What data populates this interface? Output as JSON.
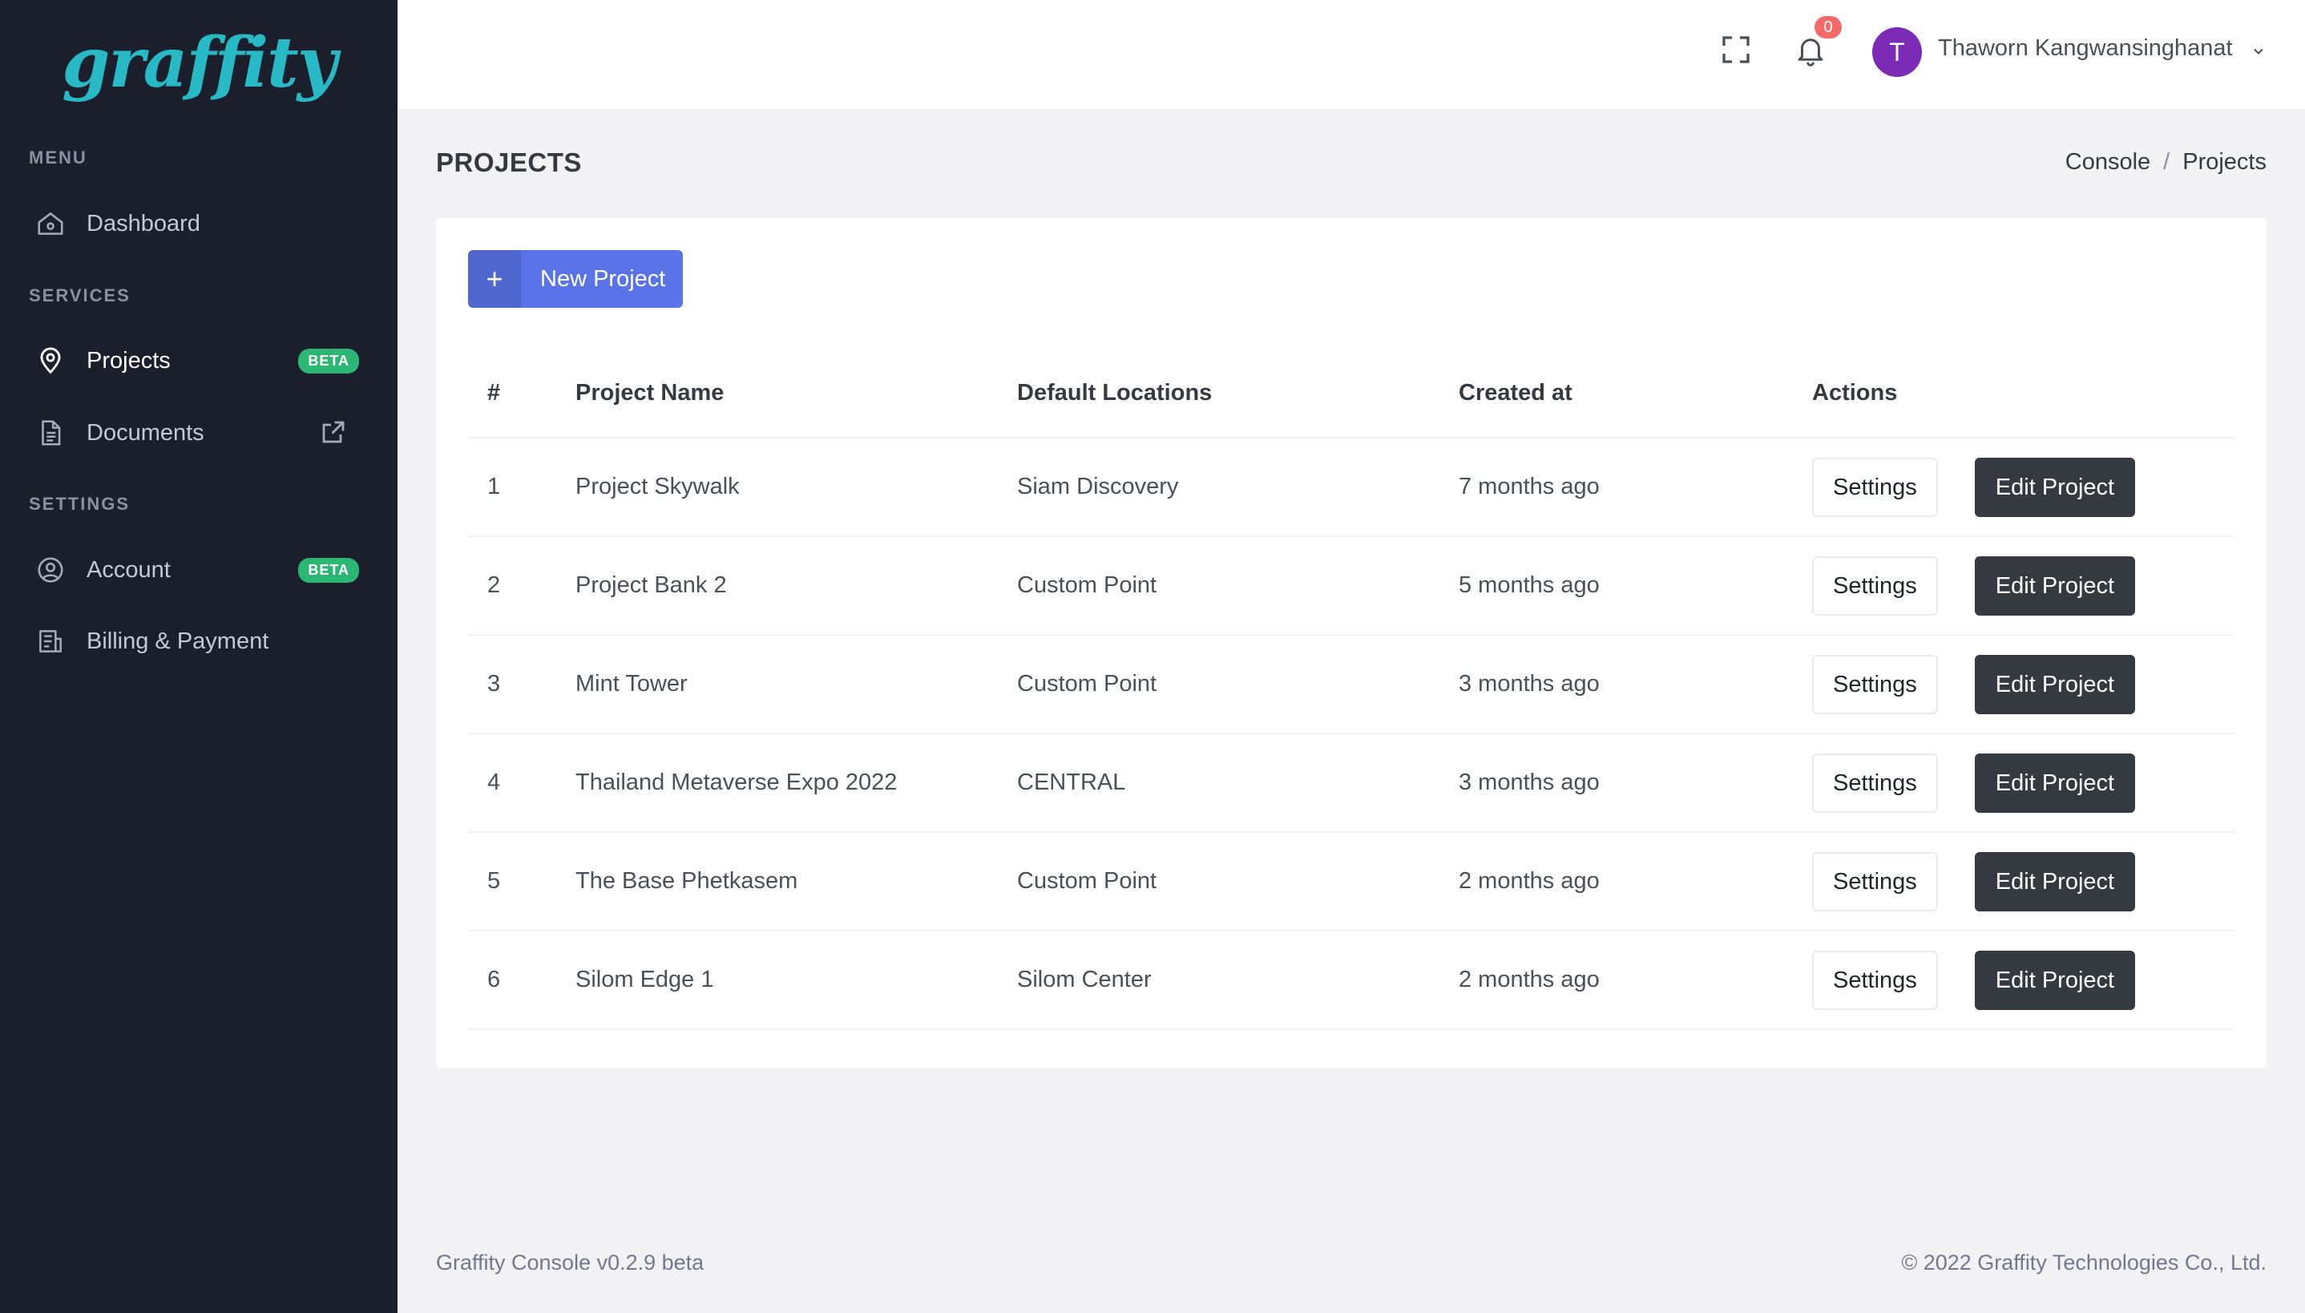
{
  "app": {
    "logo_text": "graffity"
  },
  "sidebar": {
    "menu_title": "MENU",
    "services_title": "SERVICES",
    "settings_title": "SETTINGS",
    "dashboard_label": "Dashboard",
    "projects_label": "Projects",
    "projects_badge": "BETA",
    "documents_label": "Documents",
    "account_label": "Account",
    "account_badge": "BETA",
    "billing_label": "Billing & Payment"
  },
  "topbar": {
    "notification_count": "0",
    "avatar_initial": "T",
    "user_name": "Thaworn Kangwansinghanat"
  },
  "page": {
    "title": "PROJECTS",
    "breadcrumb": [
      "Console",
      "Projects"
    ],
    "breadcrumb_sep": "/"
  },
  "actions": {
    "new_project_icon": "+",
    "new_project_label": "New Project"
  },
  "table": {
    "headers": [
      "#",
      "Project Name",
      "Default Locations",
      "Created at",
      "Actions"
    ],
    "settings_label": "Settings",
    "edit_label": "Edit Project",
    "rows": [
      {
        "num": "1",
        "name": "Project Skywalk",
        "location": "Siam Discovery",
        "created": "7 months ago"
      },
      {
        "num": "2",
        "name": "Project Bank 2",
        "location": "Custom Point",
        "created": "5 months ago"
      },
      {
        "num": "3",
        "name": "Mint Tower",
        "location": "Custom Point",
        "created": "3 months ago"
      },
      {
        "num": "4",
        "name": "Thailand Metaverse Expo 2022",
        "location": "CENTRAL",
        "created": "3 months ago"
      },
      {
        "num": "5",
        "name": "The Base Phetkasem",
        "location": "Custom Point",
        "created": "2 months ago"
      },
      {
        "num": "6",
        "name": "Silom Edge 1",
        "location": "Silom Center",
        "created": "2 months ago"
      }
    ]
  },
  "footer": {
    "version": "Graffity Console v0.2.9 beta",
    "copyright": "© 2022 Graffity Technologies Co., Ltd."
  },
  "colors": {
    "sidebar_bg": "#1b1e2b",
    "logo": "#27b9c6",
    "primary": "#5b73e8",
    "beta_badge": "#2bb673",
    "dark_button": "#343a40",
    "notification": "#f46a6a",
    "avatar": "#7b2bb6"
  }
}
